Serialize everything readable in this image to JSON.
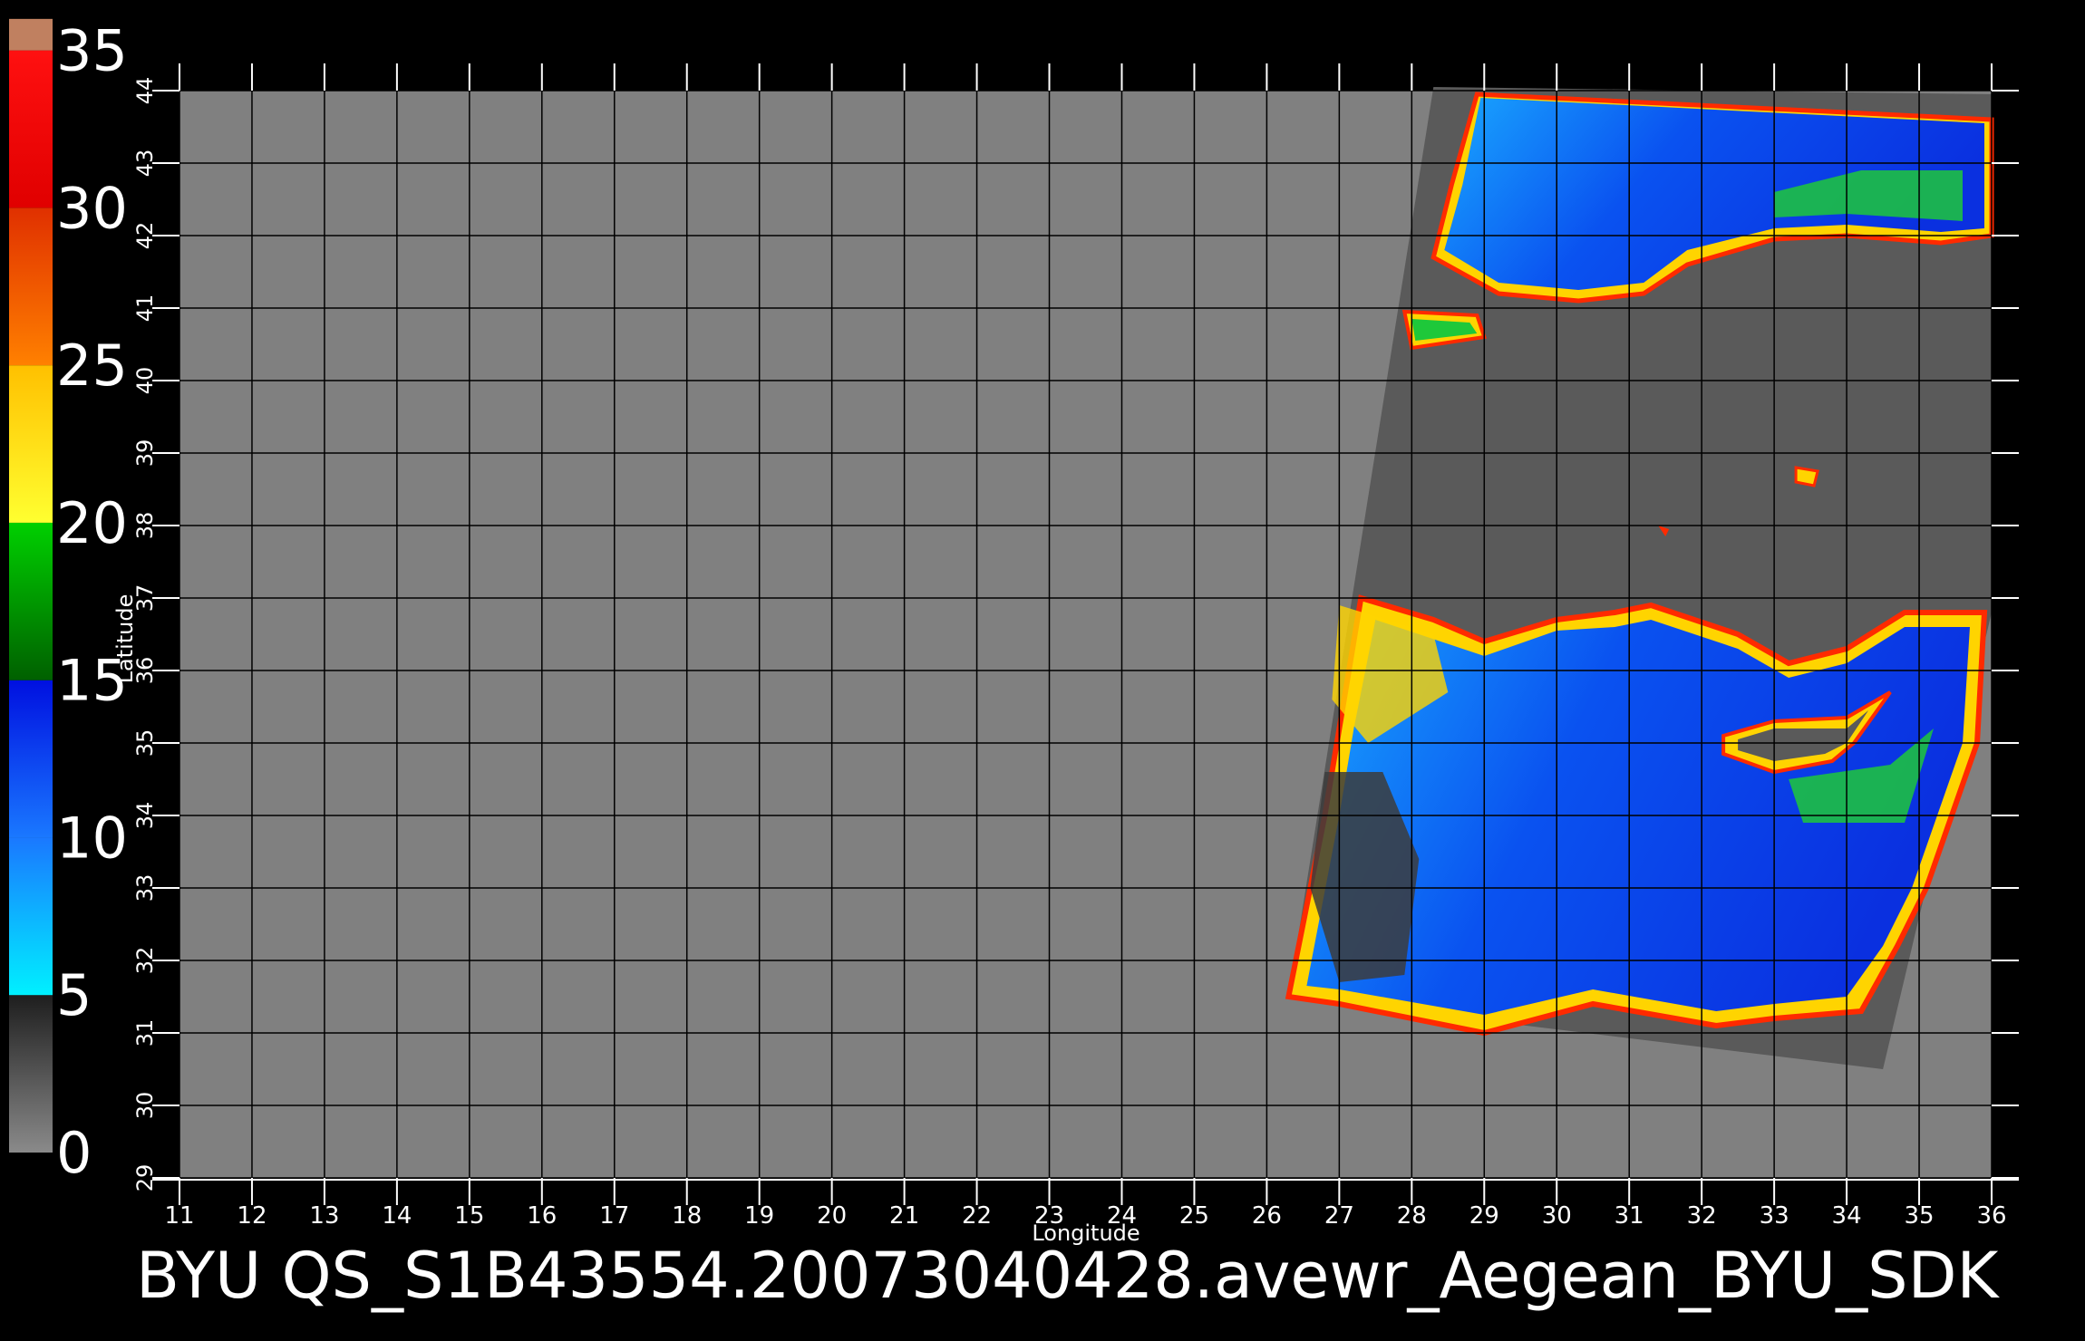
{
  "colorbar": {
    "labels": [
      "35",
      "30",
      "25",
      "20",
      "15",
      "10",
      "5",
      "0"
    ],
    "bands": [
      {
        "from": 0,
        "to": 5,
        "color_top": "#1e1e1e",
        "color_bottom": "#8a8a8a"
      },
      {
        "from": 5,
        "to": 10,
        "color_top": "#1a78ff",
        "color_bottom": "#00f0ff"
      },
      {
        "from": 10,
        "to": 15,
        "color_top": "#0010e0",
        "color_bottom": "#1a78ff"
      },
      {
        "from": 15,
        "to": 20,
        "color_top": "#00d000",
        "color_bottom": "#006000"
      },
      {
        "from": 20,
        "to": 25,
        "color_top": "#ffc000",
        "color_bottom": "#ffff30"
      },
      {
        "from": 25,
        "to": 30,
        "color_top": "#e03000",
        "color_bottom": "#ff8000"
      },
      {
        "from": 30,
        "to": 35,
        "color_top": "#ff1010",
        "color_bottom": "#e00000"
      },
      {
        "from": 35,
        "to": 36,
        "color_top": "#c08060",
        "color_bottom": "#c08060"
      }
    ]
  },
  "map": {
    "x_ticks": [
      "11",
      "12",
      "13",
      "14",
      "15",
      "16",
      "17",
      "18",
      "19",
      "20",
      "21",
      "22",
      "23",
      "24",
      "25",
      "26",
      "27",
      "28",
      "29",
      "30",
      "31",
      "32",
      "33",
      "34",
      "35",
      "36"
    ],
    "y_ticks": [
      "29",
      "30",
      "31",
      "32",
      "33",
      "34",
      "35",
      "36",
      "37",
      "38",
      "39",
      "40",
      "41",
      "42",
      "43",
      "44"
    ],
    "xlabel": "Longitude",
    "ylabel": "Latitude",
    "lon_range": [
      11,
      36
    ],
    "lat_range": [
      29,
      44
    ],
    "background_color": "#808080",
    "swath_color": "#5a5a5a",
    "land_color": "#5a5a5a"
  },
  "caption": "BYU  QS_S1B43554.20073040428.avewr_Aegean_BYU_SDK"
}
